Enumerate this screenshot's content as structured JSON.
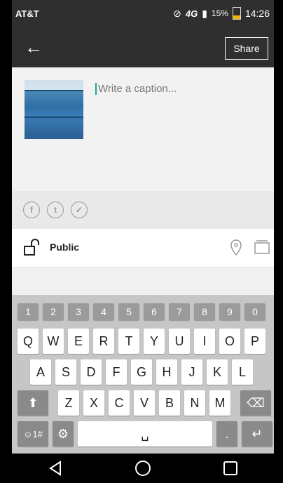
{
  "status_bar": {
    "carrier": "AT&T",
    "network": "4G",
    "battery": "15%",
    "time": "14:26"
  },
  "app_bar": {
    "share_label": "Share"
  },
  "compose": {
    "caption_placeholder": "Write a caption..."
  },
  "social": [
    {
      "name": "facebook",
      "glyph": "f"
    },
    {
      "name": "tumblr",
      "glyph": "t"
    },
    {
      "name": "twitter",
      "glyph": "✓"
    }
  ],
  "privacy": {
    "label": "Public"
  },
  "keyboard": {
    "number_row": [
      "1",
      "2",
      "3",
      "4",
      "5",
      "6",
      "7",
      "8",
      "9",
      "0"
    ],
    "row1": [
      "Q",
      "W",
      "E",
      "R",
      "T",
      "Y",
      "U",
      "I",
      "O",
      "P"
    ],
    "row2": [
      "A",
      "S",
      "D",
      "F",
      "G",
      "H",
      "J",
      "K",
      "L"
    ],
    "row3": [
      "Z",
      "X",
      "C",
      "V",
      "B",
      "N",
      "M"
    ],
    "symbols_label": "☺1#",
    "period_label": "."
  }
}
